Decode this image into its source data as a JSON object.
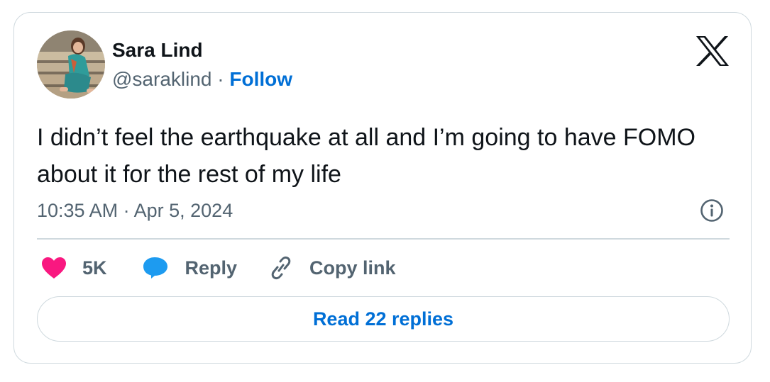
{
  "author": {
    "name": "Sara Lind",
    "handle": "@saraklind",
    "separator": "·",
    "follow_label": "Follow"
  },
  "tweet": {
    "text": "I didn’t feel the earthquake at all and I’m going to have FOMO about it for the rest of my life",
    "time": "10:35 AM",
    "date_separator": "·",
    "date": "Apr 5, 2024"
  },
  "actions": {
    "like_count": "5K",
    "reply_label": "Reply",
    "copy_label": "Copy link"
  },
  "footer": {
    "read_replies_label": "Read 22 replies"
  },
  "icons": {
    "brand": "x-logo-icon",
    "info": "info-icon",
    "like": "heart-icon",
    "reply": "speech-bubble-icon",
    "copy": "link-icon"
  },
  "colors": {
    "accent": "#006fd6",
    "like": "#f91880",
    "reply": "#1d9bf0",
    "secondary_text": "#536471",
    "border": "#cfd9de"
  }
}
